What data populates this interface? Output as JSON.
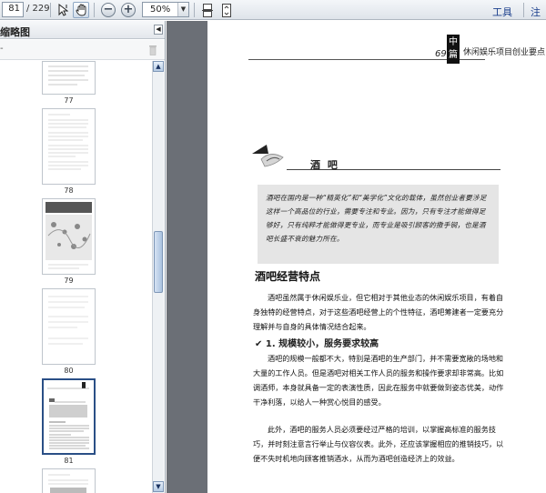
{
  "toolbar": {
    "page_current": "81",
    "page_total": "/ 229",
    "zoom": "50%",
    "tools_label": "工具",
    "comment_label": "注释"
  },
  "sidebar": {
    "title": "缩略图",
    "options_label": "-",
    "thumbnails": [
      {
        "label": "77"
      },
      {
        "label": "78"
      },
      {
        "label": "79"
      },
      {
        "label": "80"
      },
      {
        "label": "81",
        "selected": true
      },
      {
        "label": ""
      }
    ]
  },
  "document": {
    "header_page_number": "69",
    "header_badge": "中篇",
    "header_right": "休闲娱乐项目创业要点",
    "chapter_title": "酒 吧",
    "intro": "酒吧在国内是一种“精英化”和“美学化”文化的载体，虽然创业者要涉足这样一个高品位的行业，需要专注和专业。因为，只有专注才能做得足够好，只有纯粹才能做得更专业，而专业是吸引顾客的撒手锏，也是酒吧长盛不衰的魅力所在。",
    "section_title": "酒吧经营特点",
    "paragraph1": "酒吧虽然属于休闲娱乐业，但它相对于其他业态的休闲娱乐项目，有着自身独特的经营特点，对于这些酒吧经营上的个性特征，酒吧筹建者一定要充分理解并与自身的具体情况结合起来。",
    "subsection_title": "✔ 1. 规模较小，服务要求较高",
    "paragraph2": "酒吧的规模一般都不大，特别是酒吧的生产部门，并不需要宽敞的场地和大量的工作人员。但是酒吧对相关工作人员的服务和操作要求却非常高。比如调酒师，本身就具备一定的表演性质，因此在服务中就要做到姿态优美，动作干净利落，以给人一种赏心悦目的感受。",
    "paragraph3": "此外，酒吧的服务人员必须要经过严格的培训，以掌握高标准的服务技巧，并时刻注意言行举止与仪容仪表。此外，还应该掌握相应的推销技巧，以便不失时机地向顾客推销酒水，从而为酒吧创造经济上的效益。"
  },
  "colors": {
    "workspace": "#6b6f76",
    "selected_border": "#2a4f86",
    "link": "#1a3e8c"
  }
}
